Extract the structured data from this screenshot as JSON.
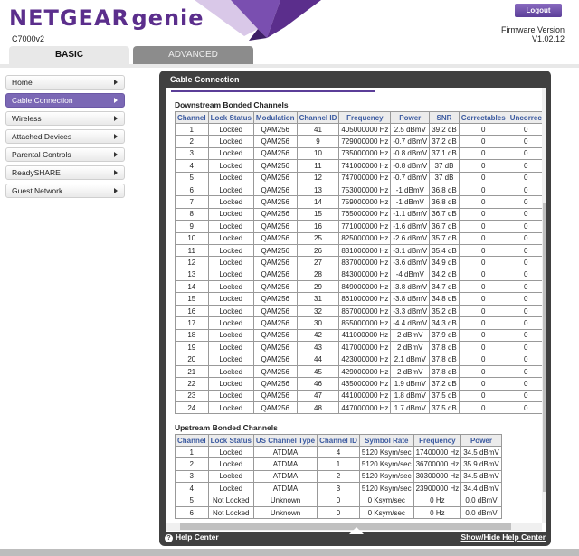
{
  "header": {
    "brand_main": "NETGEAR",
    "brand_sub": "genie",
    "model": "C7000v2",
    "logout_label": "Logout",
    "firmware_label": "Firmware Version",
    "firmware_value": "V1.02.12"
  },
  "tabs": [
    {
      "label": "BASIC",
      "active": true
    },
    {
      "label": "ADVANCED",
      "active": false
    }
  ],
  "sidebar": {
    "items": [
      {
        "label": "Home"
      },
      {
        "label": "Cable Connection",
        "active": true
      },
      {
        "label": "Wireless"
      },
      {
        "label": "Attached Devices"
      },
      {
        "label": "Parental Controls"
      },
      {
        "label": "ReadySHARE"
      },
      {
        "label": "Guest Network"
      }
    ]
  },
  "panel": {
    "title": "Cable Connection",
    "help_left": "Help Center",
    "help_right": "Show/Hide Help Center"
  },
  "downstream": {
    "title": "Downstream Bonded Channels",
    "headers": [
      "Channel",
      "Lock Status",
      "Modulation",
      "Channel ID",
      "Frequency",
      "Power",
      "SNR",
      "Correctables",
      "Uncorrec"
    ],
    "rows": [
      [
        "1",
        "Locked",
        "QAM256",
        "41",
        "405000000 Hz",
        "2.5 dBmV",
        "39.2 dB",
        "0",
        "0"
      ],
      [
        "2",
        "Locked",
        "QAM256",
        "9",
        "729000000 Hz",
        "-0.7 dBmV",
        "37.2 dB",
        "0",
        "0"
      ],
      [
        "3",
        "Locked",
        "QAM256",
        "10",
        "735000000 Hz",
        "-0.8 dBmV",
        "37.1 dB",
        "0",
        "0"
      ],
      [
        "4",
        "Locked",
        "QAM256",
        "11",
        "741000000 Hz",
        "-0.8 dBmV",
        "37 dB",
        "0",
        "0"
      ],
      [
        "5",
        "Locked",
        "QAM256",
        "12",
        "747000000 Hz",
        "-0.7 dBmV",
        "37 dB",
        "0",
        "0"
      ],
      [
        "6",
        "Locked",
        "QAM256",
        "13",
        "753000000 Hz",
        "-1 dBmV",
        "36.8 dB",
        "0",
        "0"
      ],
      [
        "7",
        "Locked",
        "QAM256",
        "14",
        "759000000 Hz",
        "-1 dBmV",
        "36.8 dB",
        "0",
        "0"
      ],
      [
        "8",
        "Locked",
        "QAM256",
        "15",
        "765000000 Hz",
        "-1.1 dBmV",
        "36.7 dB",
        "0",
        "0"
      ],
      [
        "9",
        "Locked",
        "QAM256",
        "16",
        "771000000 Hz",
        "-1.6 dBmV",
        "36.7 dB",
        "0",
        "0"
      ],
      [
        "10",
        "Locked",
        "QAM256",
        "25",
        "825000000 Hz",
        "-2.6 dBmV",
        "35.7 dB",
        "0",
        "0"
      ],
      [
        "11",
        "Locked",
        "QAM256",
        "26",
        "831000000 Hz",
        "-3.1 dBmV",
        "35.4 dB",
        "0",
        "0"
      ],
      [
        "12",
        "Locked",
        "QAM256",
        "27",
        "837000000 Hz",
        "-3.6 dBmV",
        "34.9 dB",
        "0",
        "0"
      ],
      [
        "13",
        "Locked",
        "QAM256",
        "28",
        "843000000 Hz",
        "-4 dBmV",
        "34.2 dB",
        "0",
        "0"
      ],
      [
        "14",
        "Locked",
        "QAM256",
        "29",
        "849000000 Hz",
        "-3.8 dBmV",
        "34.7 dB",
        "0",
        "0"
      ],
      [
        "15",
        "Locked",
        "QAM256",
        "31",
        "861000000 Hz",
        "-3.8 dBmV",
        "34.8 dB",
        "0",
        "0"
      ],
      [
        "16",
        "Locked",
        "QAM256",
        "32",
        "867000000 Hz",
        "-3.3 dBmV",
        "35.2 dB",
        "0",
        "0"
      ],
      [
        "17",
        "Locked",
        "QAM256",
        "30",
        "855000000 Hz",
        "-4.4 dBmV",
        "34.3 dB",
        "0",
        "0"
      ],
      [
        "18",
        "Locked",
        "QAM256",
        "42",
        "411000000 Hz",
        "2 dBmV",
        "37.9 dB",
        "0",
        "0"
      ],
      [
        "19",
        "Locked",
        "QAM256",
        "43",
        "417000000 Hz",
        "2 dBmV",
        "37.8 dB",
        "0",
        "0"
      ],
      [
        "20",
        "Locked",
        "QAM256",
        "44",
        "423000000 Hz",
        "2.1 dBmV",
        "37.8 dB",
        "0",
        "0"
      ],
      [
        "21",
        "Locked",
        "QAM256",
        "45",
        "429000000 Hz",
        "2 dBmV",
        "37.8 dB",
        "0",
        "0"
      ],
      [
        "22",
        "Locked",
        "QAM256",
        "46",
        "435000000 Hz",
        "1.9 dBmV",
        "37.2 dB",
        "0",
        "0"
      ],
      [
        "23",
        "Locked",
        "QAM256",
        "47",
        "441000000 Hz",
        "1.8 dBmV",
        "37.5 dB",
        "0",
        "0"
      ],
      [
        "24",
        "Locked",
        "QAM256",
        "48",
        "447000000 Hz",
        "1.7 dBmV",
        "37.5 dB",
        "0",
        "0"
      ]
    ]
  },
  "upstream": {
    "title": "Upstream Bonded Channels",
    "headers": [
      "Channel",
      "Lock Status",
      "US Channel Type",
      "Channel ID",
      "Symbol Rate",
      "Frequency",
      "Power"
    ],
    "rows": [
      [
        "1",
        "Locked",
        "ATDMA",
        "4",
        "5120 Ksym/sec",
        "17400000 Hz",
        "34.5 dBmV"
      ],
      [
        "2",
        "Locked",
        "ATDMA",
        "1",
        "5120 Ksym/sec",
        "36700000 Hz",
        "35.9 dBmV"
      ],
      [
        "3",
        "Locked",
        "ATDMA",
        "2",
        "5120 Ksym/sec",
        "30300000 Hz",
        "34.5 dBmV"
      ],
      [
        "4",
        "Locked",
        "ATDMA",
        "3",
        "5120 Ksym/sec",
        "23900000 Hz",
        "34.4 dBmV"
      ],
      [
        "5",
        "Not Locked",
        "Unknown",
        "0",
        "0 Ksym/sec",
        "0 Hz",
        "0.0 dBmV"
      ],
      [
        "6",
        "Not Locked",
        "Unknown",
        "0",
        "0 Ksym/sec",
        "0 Hz",
        "0.0 dBmV"
      ]
    ]
  },
  "colors": {
    "brand_purple": "#5b2e8c",
    "accent_orange": "#f39c12",
    "active_nav": "#7b68b5",
    "header_text": "#3b5aa0"
  }
}
